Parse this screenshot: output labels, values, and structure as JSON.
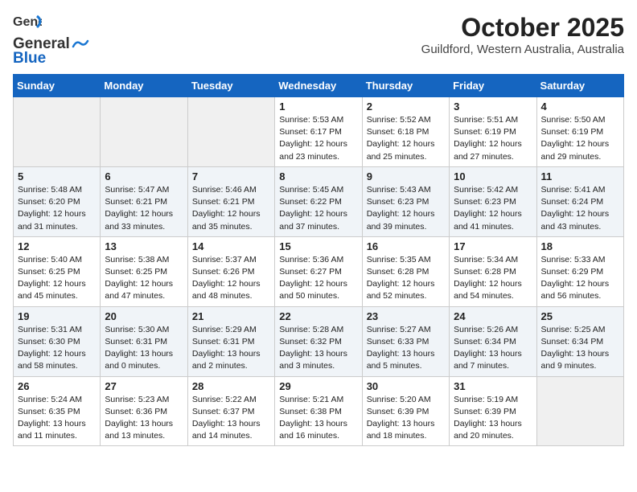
{
  "logo": {
    "line1": "General",
    "line2": "Blue"
  },
  "title": "October 2025",
  "subtitle": "Guildford, Western Australia, Australia",
  "weekdays": [
    "Sunday",
    "Monday",
    "Tuesday",
    "Wednesday",
    "Thursday",
    "Friday",
    "Saturday"
  ],
  "weeks": [
    [
      {
        "day": "",
        "info": ""
      },
      {
        "day": "",
        "info": ""
      },
      {
        "day": "",
        "info": ""
      },
      {
        "day": "1",
        "info": "Sunrise: 5:53 AM\nSunset: 6:17 PM\nDaylight: 12 hours\nand 23 minutes."
      },
      {
        "day": "2",
        "info": "Sunrise: 5:52 AM\nSunset: 6:18 PM\nDaylight: 12 hours\nand 25 minutes."
      },
      {
        "day": "3",
        "info": "Sunrise: 5:51 AM\nSunset: 6:19 PM\nDaylight: 12 hours\nand 27 minutes."
      },
      {
        "day": "4",
        "info": "Sunrise: 5:50 AM\nSunset: 6:19 PM\nDaylight: 12 hours\nand 29 minutes."
      }
    ],
    [
      {
        "day": "5",
        "info": "Sunrise: 5:48 AM\nSunset: 6:20 PM\nDaylight: 12 hours\nand 31 minutes."
      },
      {
        "day": "6",
        "info": "Sunrise: 5:47 AM\nSunset: 6:21 PM\nDaylight: 12 hours\nand 33 minutes."
      },
      {
        "day": "7",
        "info": "Sunrise: 5:46 AM\nSunset: 6:21 PM\nDaylight: 12 hours\nand 35 minutes."
      },
      {
        "day": "8",
        "info": "Sunrise: 5:45 AM\nSunset: 6:22 PM\nDaylight: 12 hours\nand 37 minutes."
      },
      {
        "day": "9",
        "info": "Sunrise: 5:43 AM\nSunset: 6:23 PM\nDaylight: 12 hours\nand 39 minutes."
      },
      {
        "day": "10",
        "info": "Sunrise: 5:42 AM\nSunset: 6:23 PM\nDaylight: 12 hours\nand 41 minutes."
      },
      {
        "day": "11",
        "info": "Sunrise: 5:41 AM\nSunset: 6:24 PM\nDaylight: 12 hours\nand 43 minutes."
      }
    ],
    [
      {
        "day": "12",
        "info": "Sunrise: 5:40 AM\nSunset: 6:25 PM\nDaylight: 12 hours\nand 45 minutes."
      },
      {
        "day": "13",
        "info": "Sunrise: 5:38 AM\nSunset: 6:25 PM\nDaylight: 12 hours\nand 47 minutes."
      },
      {
        "day": "14",
        "info": "Sunrise: 5:37 AM\nSunset: 6:26 PM\nDaylight: 12 hours\nand 48 minutes."
      },
      {
        "day": "15",
        "info": "Sunrise: 5:36 AM\nSunset: 6:27 PM\nDaylight: 12 hours\nand 50 minutes."
      },
      {
        "day": "16",
        "info": "Sunrise: 5:35 AM\nSunset: 6:28 PM\nDaylight: 12 hours\nand 52 minutes."
      },
      {
        "day": "17",
        "info": "Sunrise: 5:34 AM\nSunset: 6:28 PM\nDaylight: 12 hours\nand 54 minutes."
      },
      {
        "day": "18",
        "info": "Sunrise: 5:33 AM\nSunset: 6:29 PM\nDaylight: 12 hours\nand 56 minutes."
      }
    ],
    [
      {
        "day": "19",
        "info": "Sunrise: 5:31 AM\nSunset: 6:30 PM\nDaylight: 12 hours\nand 58 minutes."
      },
      {
        "day": "20",
        "info": "Sunrise: 5:30 AM\nSunset: 6:31 PM\nDaylight: 13 hours\nand 0 minutes."
      },
      {
        "day": "21",
        "info": "Sunrise: 5:29 AM\nSunset: 6:31 PM\nDaylight: 13 hours\nand 2 minutes."
      },
      {
        "day": "22",
        "info": "Sunrise: 5:28 AM\nSunset: 6:32 PM\nDaylight: 13 hours\nand 3 minutes."
      },
      {
        "day": "23",
        "info": "Sunrise: 5:27 AM\nSunset: 6:33 PM\nDaylight: 13 hours\nand 5 minutes."
      },
      {
        "day": "24",
        "info": "Sunrise: 5:26 AM\nSunset: 6:34 PM\nDaylight: 13 hours\nand 7 minutes."
      },
      {
        "day": "25",
        "info": "Sunrise: 5:25 AM\nSunset: 6:34 PM\nDaylight: 13 hours\nand 9 minutes."
      }
    ],
    [
      {
        "day": "26",
        "info": "Sunrise: 5:24 AM\nSunset: 6:35 PM\nDaylight: 13 hours\nand 11 minutes."
      },
      {
        "day": "27",
        "info": "Sunrise: 5:23 AM\nSunset: 6:36 PM\nDaylight: 13 hours\nand 13 minutes."
      },
      {
        "day": "28",
        "info": "Sunrise: 5:22 AM\nSunset: 6:37 PM\nDaylight: 13 hours\nand 14 minutes."
      },
      {
        "day": "29",
        "info": "Sunrise: 5:21 AM\nSunset: 6:38 PM\nDaylight: 13 hours\nand 16 minutes."
      },
      {
        "day": "30",
        "info": "Sunrise: 5:20 AM\nSunset: 6:39 PM\nDaylight: 13 hours\nand 18 minutes."
      },
      {
        "day": "31",
        "info": "Sunrise: 5:19 AM\nSunset: 6:39 PM\nDaylight: 13 hours\nand 20 minutes."
      },
      {
        "day": "",
        "info": ""
      }
    ]
  ]
}
